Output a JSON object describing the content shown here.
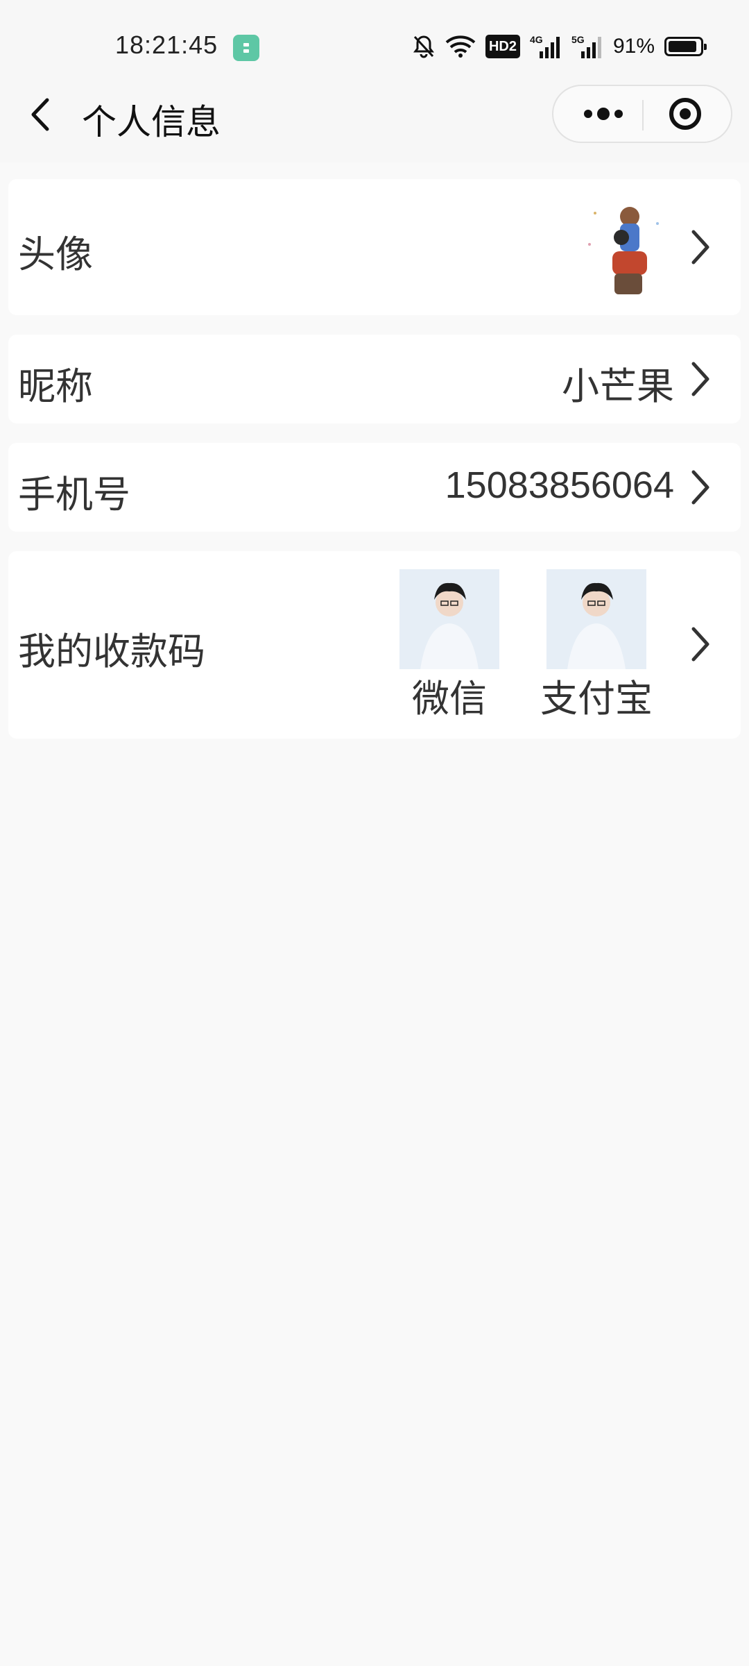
{
  "status_bar": {
    "time": "18:21:45",
    "hd_badge": "HD2",
    "net1": "4G",
    "net2": "5G",
    "battery_percent": "91%",
    "battery_level": 0.91,
    "icons": [
      "app-notification-icon",
      "mute-bell-icon",
      "wifi-icon",
      "hd-voice-icon",
      "signal-4g-icon",
      "signal-5g-icon",
      "battery-icon"
    ]
  },
  "nav": {
    "title": "个人信息",
    "back_icon": "chevron-left-icon",
    "more_icon": "more-dots-icon",
    "close_icon": "target-circle-icon"
  },
  "rows": {
    "avatar": {
      "label": "头像"
    },
    "nickname": {
      "label": "昵称",
      "value": "小芒果"
    },
    "phone": {
      "label": "手机号",
      "value": "15083856064"
    },
    "payment_codes": {
      "label": "我的收款码",
      "items": [
        {
          "label": "微信"
        },
        {
          "label": "支付宝"
        }
      ]
    }
  },
  "colors": {
    "page_bg": "#f9f9f9",
    "card_bg": "#ffffff",
    "text": "#333333",
    "status_app_icon": "#5ec7a5"
  }
}
